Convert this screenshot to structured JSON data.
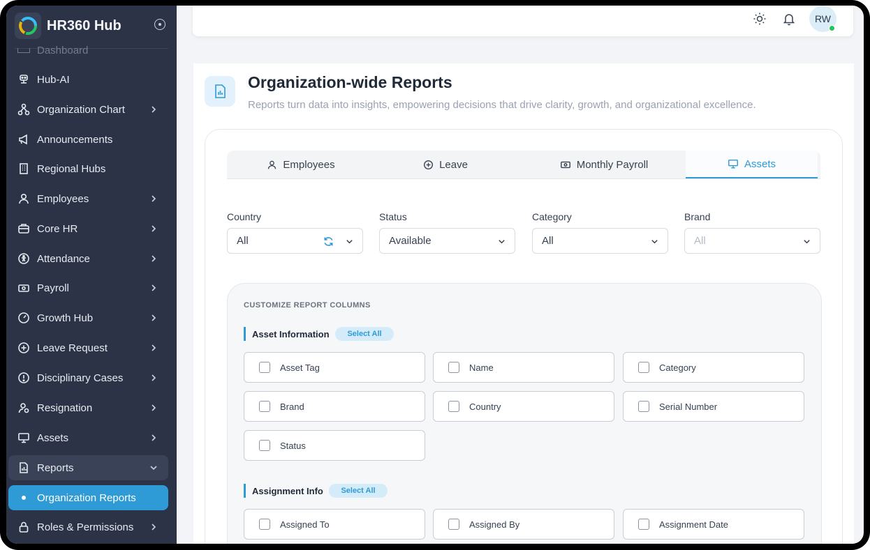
{
  "app": {
    "title": "HR360 Hub"
  },
  "sidebar": {
    "faded_item": "Dashboard",
    "items": [
      {
        "label": "Hub-AI",
        "icon": "robot-icon",
        "chevron": false
      },
      {
        "label": "Organization Chart",
        "icon": "org-chart-icon",
        "chevron": true
      },
      {
        "label": "Announcements",
        "icon": "megaphone-icon",
        "chevron": false
      },
      {
        "label": "Regional Hubs",
        "icon": "building-icon",
        "chevron": false
      },
      {
        "label": "Employees",
        "icon": "user-icon",
        "chevron": true
      },
      {
        "label": "Core HR",
        "icon": "briefcase-icon",
        "chevron": true
      },
      {
        "label": "Attendance",
        "icon": "attendance-icon",
        "chevron": true
      },
      {
        "label": "Payroll",
        "icon": "money-icon",
        "chevron": true
      },
      {
        "label": "Growth Hub",
        "icon": "gauge-icon",
        "chevron": true
      },
      {
        "label": "Leave Request",
        "icon": "plus-circle-icon",
        "chevron": true
      },
      {
        "label": "Disciplinary Cases",
        "icon": "alert-circle-icon",
        "chevron": true
      },
      {
        "label": "Resignation",
        "icon": "user-minus-icon",
        "chevron": true
      },
      {
        "label": "Assets",
        "icon": "monitor-icon",
        "chevron": true
      },
      {
        "label": "Reports",
        "icon": "report-icon",
        "chevron": "down"
      },
      {
        "label": "Organization Reports",
        "icon": "dot",
        "chevron": false,
        "active": true
      },
      {
        "label": "Roles & Permissions",
        "icon": "lock-icon",
        "chevron": true
      }
    ]
  },
  "topbar": {
    "avatar_initials": "RW",
    "status": "online",
    "icons": [
      "sun-icon",
      "bell-icon"
    ]
  },
  "page": {
    "title": "Organization-wide Reports",
    "subtitle": "Reports turn data into insights, empowering decisions that drive clarity, growth, and organizational excellence."
  },
  "tabs": [
    {
      "label": "Employees",
      "icon": "user-icon"
    },
    {
      "label": "Leave",
      "icon": "plus-circle-icon"
    },
    {
      "label": "Monthly Payroll",
      "icon": "money-icon"
    },
    {
      "label": "Assets",
      "icon": "monitor-icon",
      "active": true
    }
  ],
  "filters": [
    {
      "label": "Country",
      "value": "All"
    },
    {
      "label": "Status",
      "value": "Available"
    },
    {
      "label": "Category",
      "value": "All"
    },
    {
      "label": "Brand",
      "value": "All",
      "disabled": true
    }
  ],
  "customize": {
    "title": "CUSTOMIZE REPORT COLUMNS",
    "groups": [
      {
        "title": "Asset Information",
        "select_all": "Select All",
        "columns": [
          "Asset Tag",
          "Name",
          "Category",
          "Brand",
          "Country",
          "Serial Number",
          "Status"
        ]
      },
      {
        "title": "Assignment Info",
        "select_all": "Select All",
        "columns": [
          "Assigned To",
          "Assigned By",
          "Assignment Date"
        ]
      }
    ]
  },
  "colors": {
    "accent": "#2e9ad6",
    "sidebar_bg": "#2c3347"
  }
}
